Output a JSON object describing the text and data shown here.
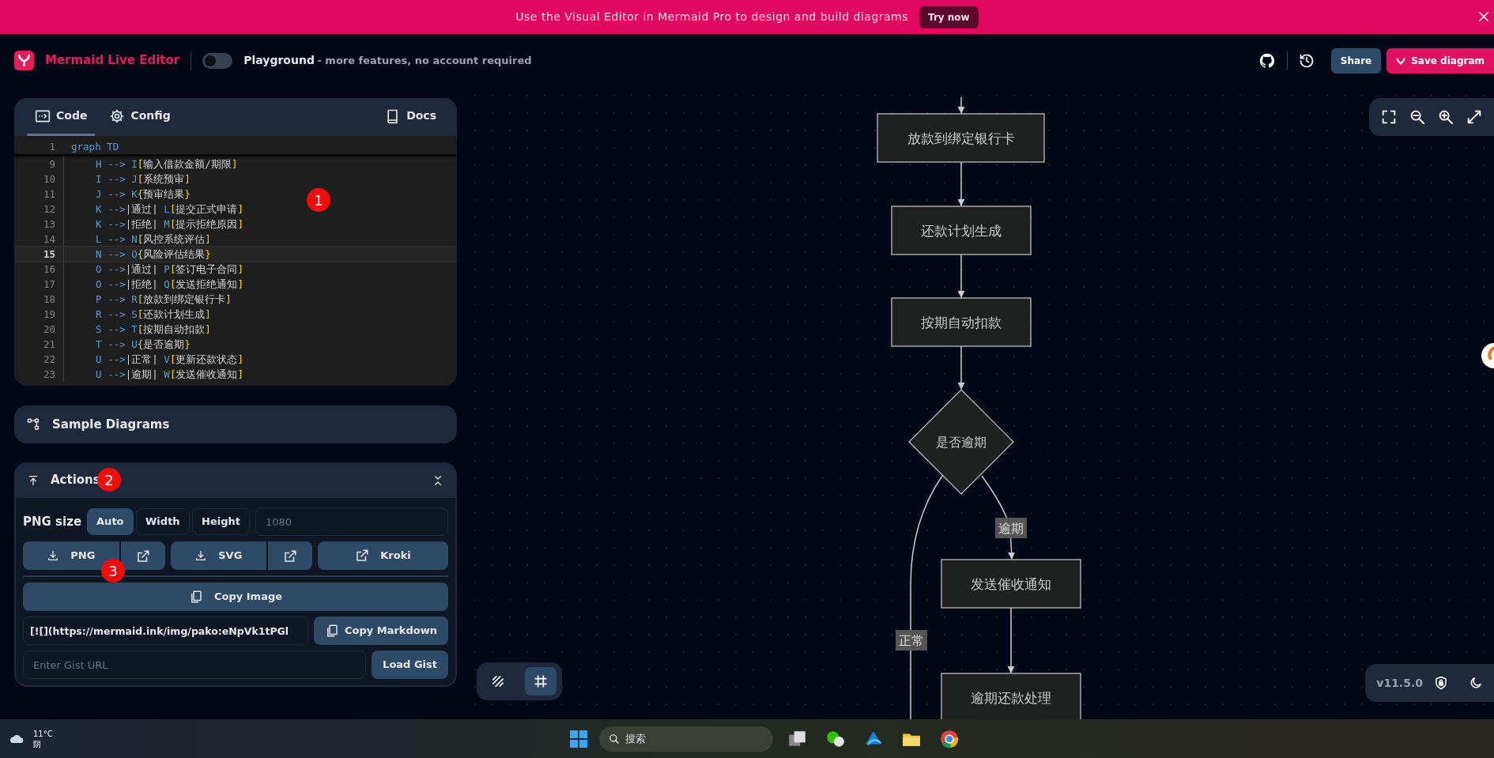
{
  "banner": {
    "text": "Use the Visual Editor in Mermaid Pro to design and build diagrams",
    "button": "Try now"
  },
  "header": {
    "title": "Mermaid Live Editor",
    "playground_toggle": {
      "on": false
    },
    "mode": "Playground",
    "mode_note": "- more features, no account required",
    "buttons": [
      "Share",
      "Save diagram"
    ]
  },
  "editor": {
    "tabs": [
      {
        "label": "Code",
        "selected": true
      },
      {
        "label": "Config",
        "selected": false
      }
    ],
    "docs": "Docs",
    "lines": [
      {
        "number": "1",
        "text": "graph TD",
        "current": false
      },
      {
        "number": "9",
        "text": "    H --> I[输入借款金额/期限]",
        "current": false
      },
      {
        "number": "10",
        "text": "    I --> J[系统预审]",
        "current": false
      },
      {
        "number": "11",
        "text": "    J --> K{预审结果}",
        "current": false
      },
      {
        "number": "12",
        "text": "    K -->|通过| L[提交正式申请]",
        "current": false
      },
      {
        "number": "13",
        "text": "    K -->|拒绝| M[提示拒绝原因]",
        "current": false
      },
      {
        "number": "14",
        "text": "    L --> N[风控系统评估]",
        "current": false
      },
      {
        "number": "15",
        "text": "    N --> O{风险评估结果}",
        "current": true
      },
      {
        "number": "16",
        "text": "    O -->|通过| P[签订电子合同]",
        "current": false
      },
      {
        "number": "17",
        "text": "    O -->|拒绝| Q[发送拒绝通知]",
        "current": false
      },
      {
        "number": "18",
        "text": "    P --> R[放款到绑定银行卡]",
        "current": false
      },
      {
        "number": "19",
        "text": "    R --> S[还款计划生成]",
        "current": false
      },
      {
        "number": "20",
        "text": "    S --> T[按期自动扣款]",
        "current": false
      },
      {
        "number": "21",
        "text": "    T --> U{是否逾期}",
        "current": false
      },
      {
        "number": "22",
        "text": "    U -->|正常| V[更新还款状态]",
        "current": false
      },
      {
        "number": "23",
        "text": "    U -->|逾期| W[发送催收通知]",
        "current": false
      }
    ]
  },
  "sample_diagrams": "Sample Diagrams",
  "actions": {
    "title": "Actions",
    "expanded": true,
    "png_size_label": "PNG size",
    "size_options": [
      {
        "label": "Auto",
        "selected": true
      },
      {
        "label": "Width",
        "selected": false
      },
      {
        "label": "Height",
        "selected": false
      }
    ],
    "size_input": {
      "placeholder": "1080"
    },
    "export_buttons": [
      {
        "label": "PNG",
        "kind": "split"
      },
      {
        "label": "SVG",
        "kind": "split"
      },
      {
        "label": "Kroki",
        "kind": "link"
      }
    ],
    "copy_image": "Copy Image",
    "markdown": {
      "value": "[![](https://mermaid.ink/img/pako:eNpVk1tPGl"
    },
    "copy_markdown": "Copy Markdown",
    "gist": {
      "placeholder": "Enter Gist URL"
    },
    "load_gist": "Load Gist"
  },
  "diagram": {
    "nodes": [
      {
        "label": "放款到绑定银行卡",
        "kind": "rect"
      },
      {
        "label": "还款计划生成",
        "kind": "rect"
      },
      {
        "label": "按期自动扣款",
        "kind": "rect"
      },
      {
        "label": "是否逾期",
        "kind": "diamond"
      },
      {
        "label": "发送催收通知",
        "kind": "rect"
      },
      {
        "label": "逾期还款处理",
        "kind": "rect"
      }
    ],
    "edge_labels": [
      "逾期",
      "正常"
    ]
  },
  "canvas_tools": [
    {
      "kind": "pen",
      "selected": false
    },
    {
      "kind": "grid",
      "selected": true
    }
  ],
  "version": "v11.5.0",
  "annotations": [
    "1",
    "2",
    "3"
  ],
  "taskbar": {
    "temperature": "11°C",
    "weather": "阴",
    "search": "搜索"
  }
}
